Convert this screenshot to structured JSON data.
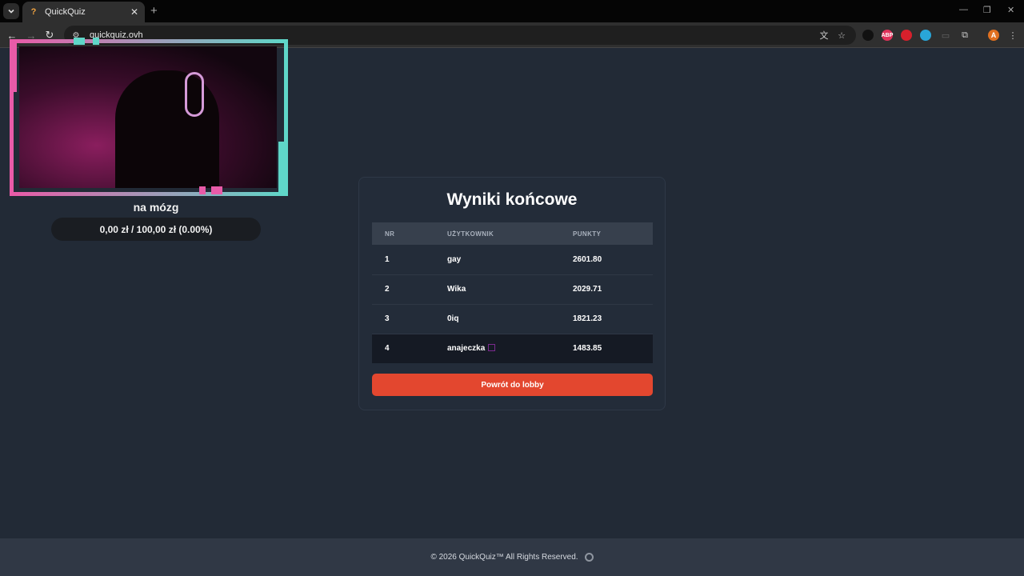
{
  "browser": {
    "tab_title": "QuickQuiz",
    "tab_favicon": "?",
    "new_tab": "+",
    "url": "quickquiz.ovh",
    "minimize": "—",
    "restore": "❐",
    "close": "✕",
    "extensions": [
      {
        "name": "ext-dark-icon",
        "label": "",
        "color": "#111111"
      },
      {
        "name": "abp-icon",
        "label": "ABP",
        "color": "#e0325a"
      },
      {
        "name": "record-icon",
        "label": "",
        "color": "#d8202c"
      },
      {
        "name": "translate-ext-icon",
        "label": "",
        "color": "#29a6d8"
      }
    ],
    "profile_initial": "A"
  },
  "stream": {
    "streamer_name": "na mózg",
    "donation_goal": "0,00 zł / 100,00 zł (0.00%)"
  },
  "results": {
    "title": "Wyniki końcowe",
    "columns": [
      "NR",
      "UŻYTKOWNIK",
      "PUNKTY"
    ],
    "rows": [
      {
        "nr": "1",
        "user": "gay",
        "points": "2601.80"
      },
      {
        "nr": "2",
        "user": "Wika",
        "points": "2029.71"
      },
      {
        "nr": "3",
        "user": "0iq",
        "points": "1821.23"
      },
      {
        "nr": "4",
        "user": "anajeczka",
        "points": "1483.85"
      }
    ],
    "back_button": "Powrót do lobby"
  },
  "footer": {
    "text": "© 2026  QuickQuiz™ All Rights Reserved."
  },
  "colors": {
    "accent": "#e3472f",
    "page_bg": "#222a36",
    "frame_pink": "#e85ba8",
    "frame_teal": "#5fd6c8"
  }
}
